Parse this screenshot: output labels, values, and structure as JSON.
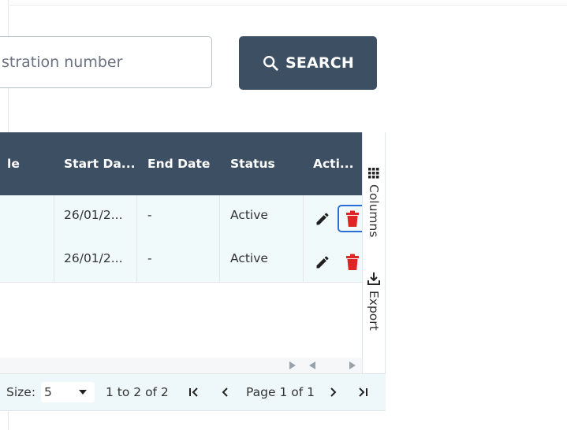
{
  "search": {
    "placeholder": "stration number",
    "button_label": "SEARCH"
  },
  "grid": {
    "columns": [
      "le",
      "Start Da...",
      "End Date",
      "Status",
      "Acti..."
    ],
    "rows": [
      {
        "start_date": "26/01/2...",
        "end_date": "-",
        "status": "Active"
      },
      {
        "start_date": "26/01/2...",
        "end_date": "-",
        "status": "Active"
      }
    ],
    "side_panel": {
      "columns_label": "Columns",
      "export_label": "Export"
    },
    "pager": {
      "page_size_label": "Size:",
      "page_size_value": "5",
      "range_text": "1 to 2 of 2",
      "page_text": "Page 1 of 1"
    }
  },
  "colors": {
    "header_bg": "#3d4f63",
    "row_bg": "#f1fafb",
    "delete_icon": "#e02424",
    "focus_ring": "#2a6fd6"
  },
  "icons": {
    "search": "search-icon",
    "edit": "pencil-icon",
    "delete": "trash-icon",
    "columns": "grid-icon",
    "export": "download-icon",
    "first": "first-page-icon",
    "prev": "chevron-left-icon",
    "next": "chevron-right-icon",
    "last": "last-page-icon",
    "dropdown": "caret-down-icon"
  }
}
